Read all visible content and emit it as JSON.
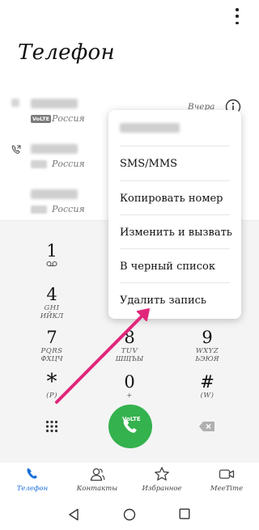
{
  "header": {
    "title": "Телефон"
  },
  "call_log": [
    {
      "country": "Россия",
      "time": "Вчера",
      "volte": "VoLTE"
    },
    {
      "country": "Россия"
    },
    {
      "country": "Россия"
    }
  ],
  "context_menu": {
    "items": [
      "SMS/MMS",
      "Копировать номер",
      "Изменить и вызвать",
      "В черный список",
      "Удалить запись"
    ]
  },
  "dialpad": {
    "keys": [
      {
        "num": "1",
        "sub": "",
        "sub2": ""
      },
      {
        "num": "4",
        "sub": "GHI",
        "sub2": "ИЙКЛ"
      },
      {
        "num": "7",
        "sub": "PQRS",
        "sub2": "ФХЦЧ"
      },
      {
        "num": "8",
        "sub": "TUV",
        "sub2": "ШЩЪЫ"
      },
      {
        "num": "9",
        "sub": "WXYZ",
        "sub2": "ЬЭЮЯ"
      },
      {
        "num": "*",
        "sub": "(P)",
        "sub2": ""
      },
      {
        "num": "0",
        "sub": "+",
        "sub2": ""
      },
      {
        "num": "#",
        "sub": "(W)",
        "sub2": ""
      }
    ],
    "call_label": "VoLTE"
  },
  "bottom_nav": {
    "tabs": [
      "Телефон",
      "Контакты",
      "Избранное",
      "MeeTime"
    ],
    "active": "Телефон"
  },
  "colors": {
    "accent": "#1a6fd8",
    "call_green": "#34b24e",
    "arrow": "#e0267a"
  }
}
